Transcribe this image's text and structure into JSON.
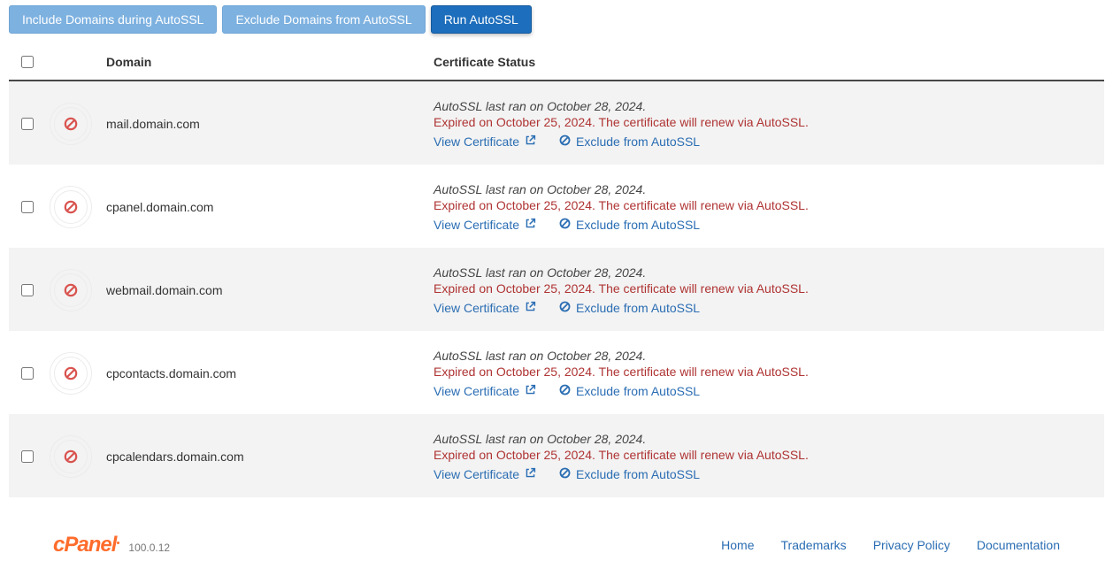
{
  "toolbar": {
    "include_label": "Include Domains during AutoSSL",
    "exclude_label": "Exclude Domains from AutoSSL",
    "run_label": "Run AutoSSL"
  },
  "headers": {
    "domain": "Domain",
    "status": "Certificate Status"
  },
  "actions": {
    "view_cert": "View Certificate",
    "exclude": "Exclude from AutoSSL"
  },
  "rows": [
    {
      "domain": "mail.domain.com",
      "last_ran": "AutoSSL last ran on October 28, 2024.",
      "expired": "Expired on October 25, 2024. The certificate will renew via AutoSSL."
    },
    {
      "domain": "cpanel.domain.com",
      "last_ran": "AutoSSL last ran on October 28, 2024.",
      "expired": "Expired on October 25, 2024. The certificate will renew via AutoSSL."
    },
    {
      "domain": "webmail.domain.com",
      "last_ran": "AutoSSL last ran on October 28, 2024.",
      "expired": "Expired on October 25, 2024. The certificate will renew via AutoSSL."
    },
    {
      "domain": "cpcontacts.domain.com",
      "last_ran": "AutoSSL last ran on October 28, 2024.",
      "expired": "Expired on October 25, 2024. The certificate will renew via AutoSSL."
    },
    {
      "domain": "cpcalendars.domain.com",
      "last_ran": "AutoSSL last ran on October 28, 2024.",
      "expired": "Expired on October 25, 2024. The certificate will renew via AutoSSL."
    }
  ],
  "footer": {
    "brand": "cPanel",
    "version": "100.0.12",
    "links": {
      "home": "Home",
      "trademarks": "Trademarks",
      "privacy": "Privacy Policy",
      "documentation": "Documentation"
    }
  }
}
